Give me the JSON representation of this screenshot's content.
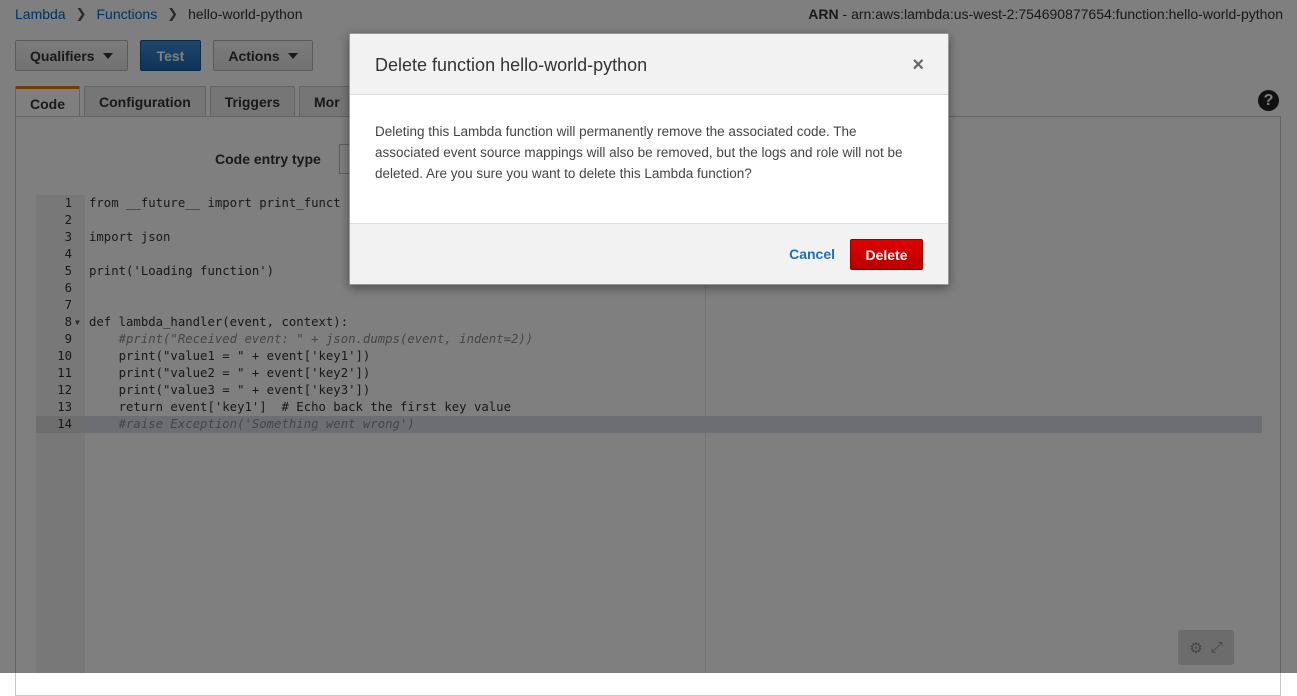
{
  "breadcrumb": {
    "root": "Lambda",
    "functions": "Functions",
    "current": "hello-world-python"
  },
  "arn": {
    "label": "ARN",
    "value": " - arn:aws:lambda:us-west-2:754690877654:function:hello-world-python"
  },
  "toolbar": {
    "qualifiers": "Qualifiers",
    "test": "Test",
    "actions": "Actions"
  },
  "tabs": [
    "Code",
    "Configuration",
    "Triggers",
    "Mor"
  ],
  "code_entry": {
    "label": "Code entry type"
  },
  "editor": {
    "lines": [
      "from __future__ import print_funct",
      "",
      "import json",
      "",
      "print('Loading function')",
      "",
      "",
      "def lambda_handler(event, context):",
      "    #print(\"Received event: \" + json.dumps(event, indent=2))",
      "    print(\"value1 = \" + event['key1'])",
      "    print(\"value2 = \" + event['key2'])",
      "    print(\"value3 = \" + event['key3'])",
      "    return event['key1']  # Echo back the first key value",
      "    #raise Exception('Something went wrong')"
    ],
    "line_numbers": [
      "1",
      "2",
      "3",
      "4",
      "5",
      "6",
      "7",
      "8",
      "9",
      "10",
      "11",
      "12",
      "13",
      "14"
    ],
    "active_line": 14
  },
  "modal": {
    "title": "Delete function hello-world-python",
    "close": "×",
    "body": "Deleting this Lambda function will permanently remove the associated code. The associated event source mappings will also be removed, but the logs and role will not be deleted. Are you sure you want to delete this Lambda function?",
    "cancel": "Cancel",
    "delete": "Delete"
  },
  "icons": {
    "help": "help-icon",
    "gear": "gear-icon",
    "expand": "expand-icon"
  }
}
